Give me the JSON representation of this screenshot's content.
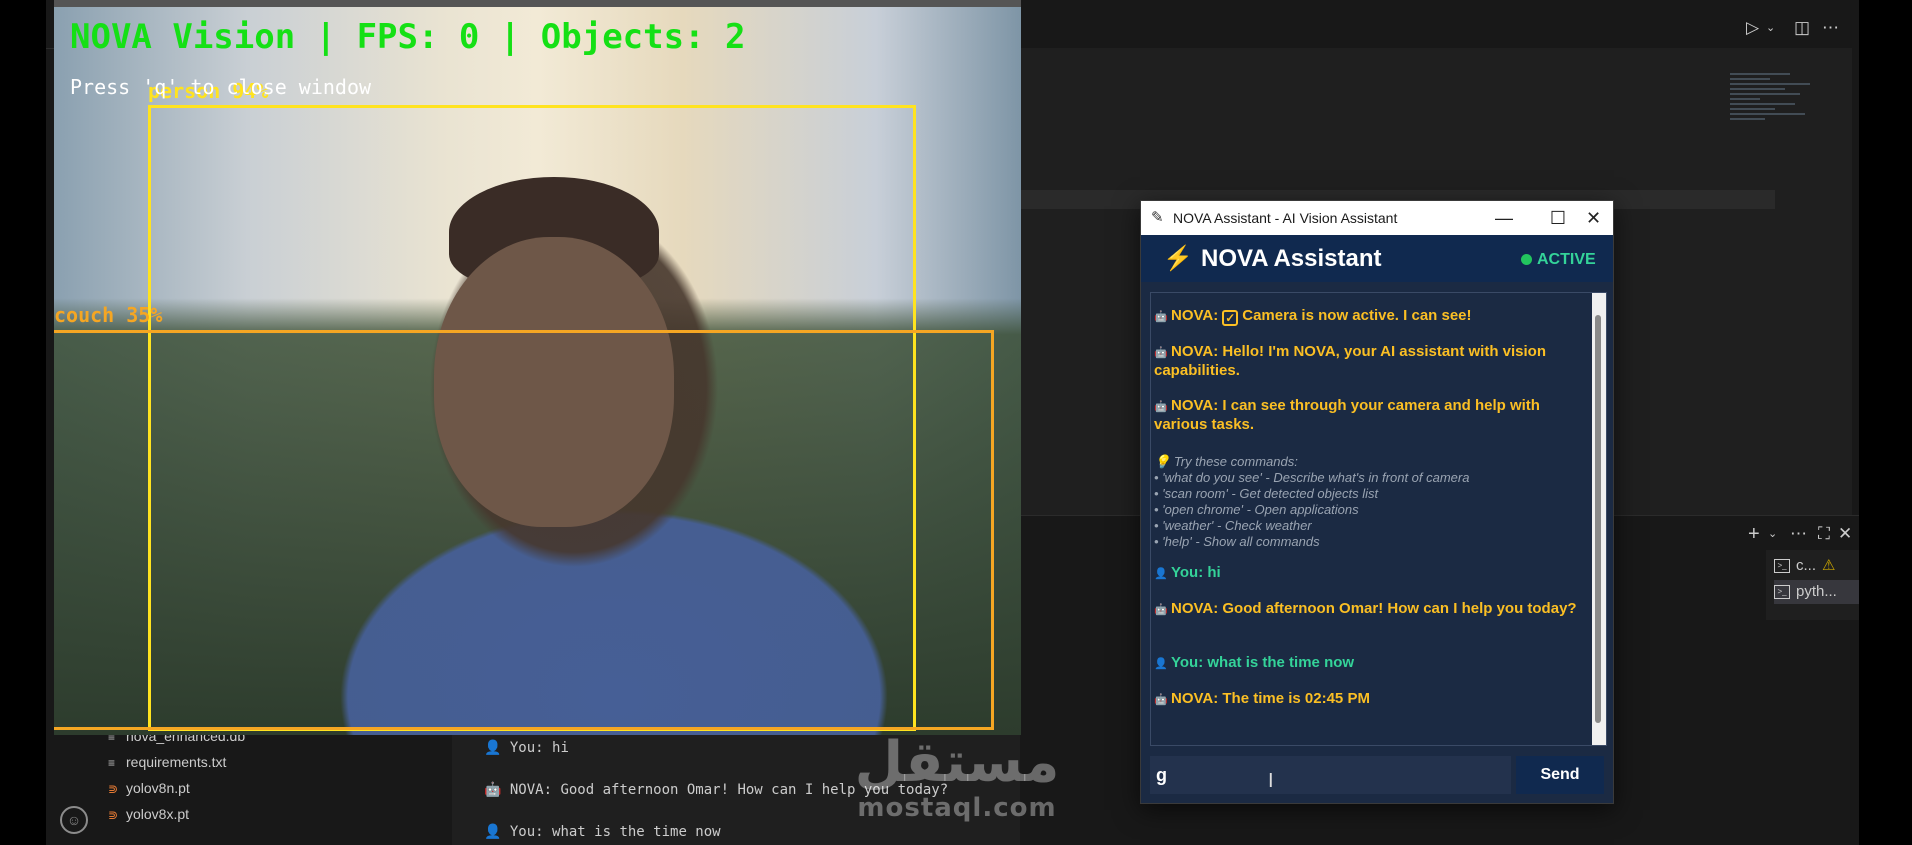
{
  "camera": {
    "hud_title": "NOVA Vision | FPS: 0 | Objects: 2",
    "hud_hint": "Press 'q' to close window",
    "detections": [
      {
        "label": "person 94%",
        "color": "#ffe31f"
      },
      {
        "label": "couch 35%",
        "color": "#f5a623"
      }
    ],
    "hud_color": "#15e015"
  },
  "nova": {
    "window_title": "NOVA Assistant - AI Vision Assistant",
    "header_title": "NOVA Assistant",
    "status": "ACTIVE",
    "status_color": "#34d399",
    "messages": {
      "m1_prefix": "NOVA:",
      "m1_text": "Camera is now active. I can see!",
      "m2": "NOVA: Hello! I'm NOVA, your AI assistant with vision capabilities.",
      "m3": "NOVA: I can see through your camera and help with various tasks.",
      "tips_title": "Try these commands:",
      "tips": [
        "• 'what do you see' - Describe what's in front of camera",
        "• 'scan room' - Get detected objects list",
        "• 'open chrome' - Open applications",
        "• 'weather' - Check weather",
        "• 'help' - Show all commands"
      ],
      "u1": "You: hi",
      "m4": "NOVA: Good afternoon Omar! How can I help you today?",
      "u2": "You: what is the time now",
      "m5": "NOVA: The time is 02:45 PM"
    },
    "input_value": "g",
    "send_label": "Send"
  },
  "explorer": {
    "files": [
      {
        "name": "nova_enhanced.db",
        "icon": "lines-icon"
      },
      {
        "name": "requirements.txt",
        "icon": "lines-icon"
      },
      {
        "name": "yolov8n.pt",
        "icon": "rss-icon"
      },
      {
        "name": "yolov8x.pt",
        "icon": "rss-icon"
      }
    ]
  },
  "terminal": {
    "lines": [
      "You: hi",
      "NOVA: Good afternoon Omar! How can I help you today?",
      "You: what is the time now"
    ],
    "tabs": [
      "c...",
      "pyth..."
    ]
  },
  "watermark": {
    "arabic": "مستقل",
    "latin": "mostaql.com"
  }
}
